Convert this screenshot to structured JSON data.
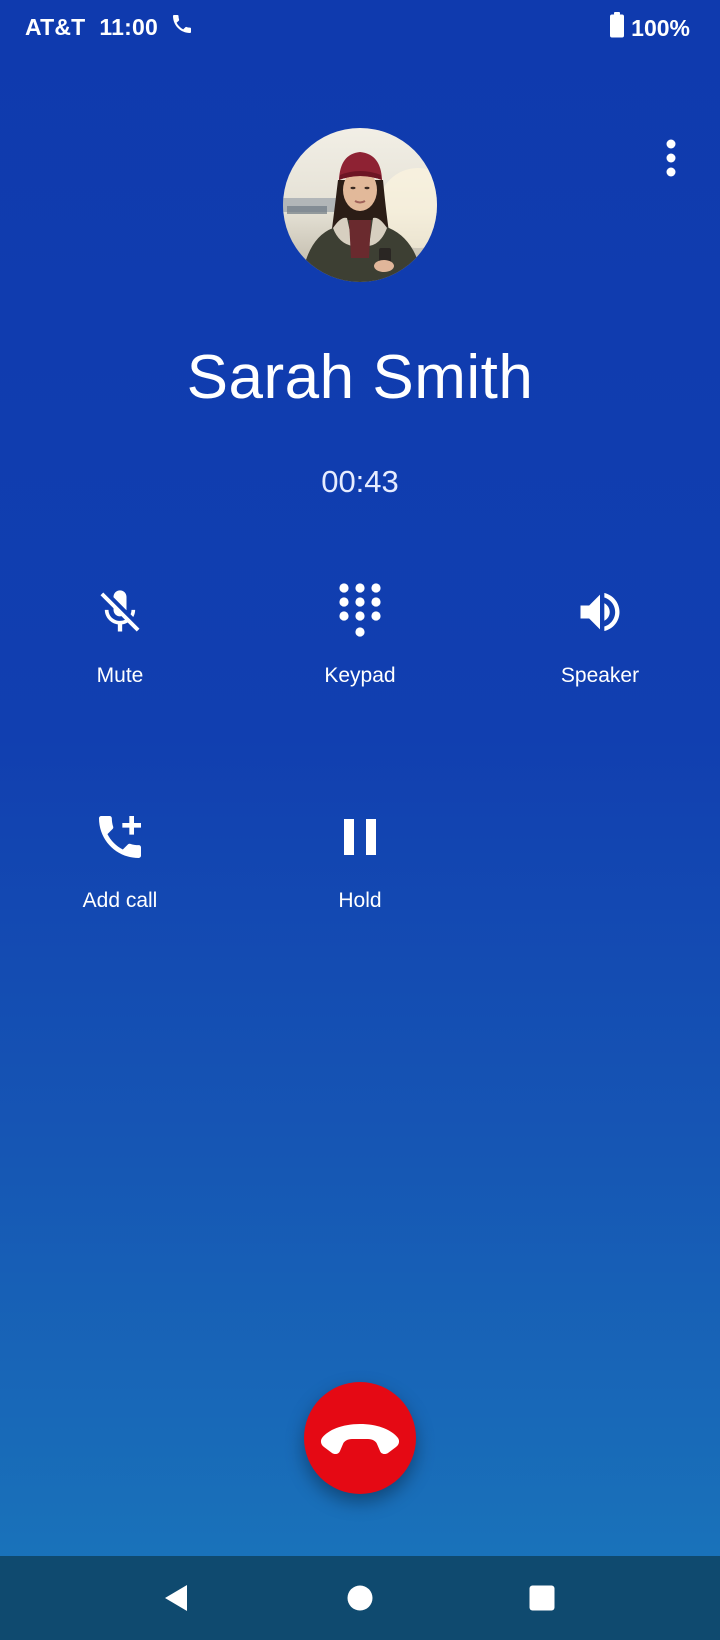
{
  "status_bar": {
    "carrier": "AT&T",
    "time": "11:00",
    "battery": "100%",
    "icons": [
      "phone-icon",
      "battery-icon"
    ]
  },
  "contact": {
    "name": "Sarah Smith",
    "timer": "00:43",
    "avatar_description": "contact-photo"
  },
  "actions": {
    "mute": {
      "label": "Mute",
      "icon": "mic-off-icon"
    },
    "keypad": {
      "label": "Keypad",
      "icon": "dialpad-icon"
    },
    "speaker": {
      "label": "Speaker",
      "icon": "volume-icon"
    },
    "add_call": {
      "label": "Add call",
      "icon": "add-call-icon"
    },
    "hold": {
      "label": "Hold",
      "icon": "pause-icon"
    }
  },
  "end_call": {
    "icon": "call-end-icon",
    "color": "#e50914"
  },
  "menu": {
    "icon": "more-vert-icon"
  },
  "nav": {
    "icons": [
      "back-icon",
      "home-icon",
      "recents-icon"
    ]
  },
  "colors": {
    "background_top": "#0f3aae",
    "background_bottom": "#1a78bb",
    "nav_bar": "#0f4a6f"
  }
}
